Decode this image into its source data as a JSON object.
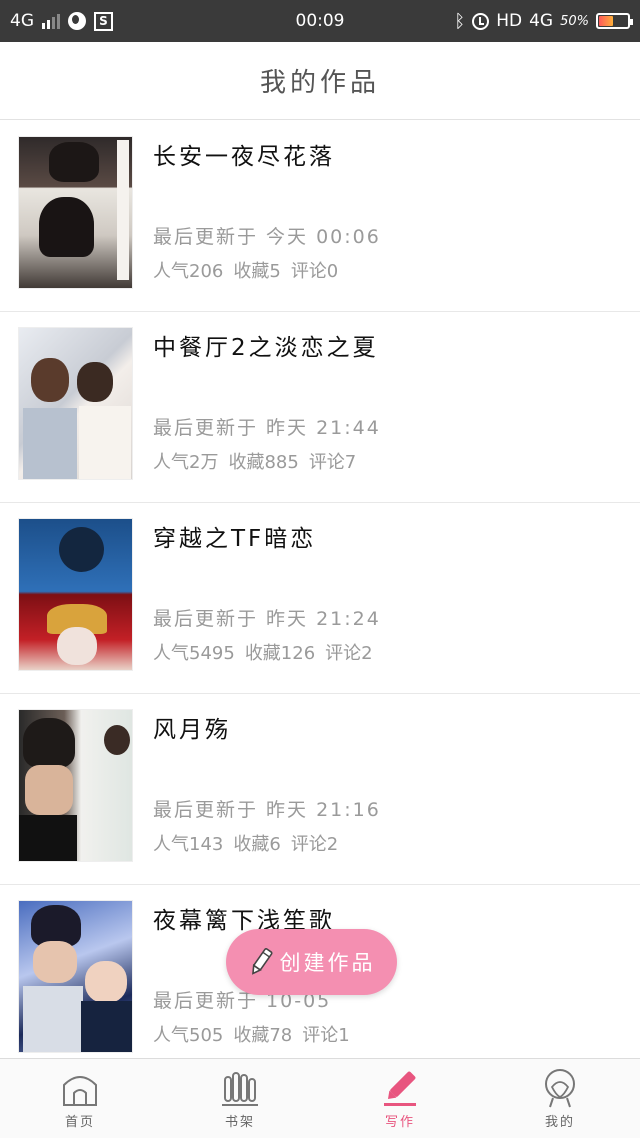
{
  "status_bar": {
    "network": "4G",
    "time": "00:09",
    "hd": "HD",
    "network_right": "4G",
    "battery_percent": "50%",
    "battery_level": 0.5,
    "icons": [
      "signal-icon",
      "globe-icon",
      "s-app-icon",
      "bluetooth-icon",
      "alarm-icon",
      "battery-icon"
    ]
  },
  "header": {
    "title": "我的作品"
  },
  "works": [
    {
      "title": "长安一夜尽花落",
      "updated": "最后更新于 今天 00:06",
      "popularity": "人气206",
      "favorites": "收藏5",
      "comments": "评论0"
    },
    {
      "title": "中餐厅2之淡恋之夏",
      "updated": "最后更新于 昨天 21:44",
      "popularity": "人气2万",
      "favorites": "收藏885",
      "comments": "评论7"
    },
    {
      "title": "穿越之TF暗恋",
      "updated": "最后更新于 昨天 21:24",
      "popularity": "人气5495",
      "favorites": "收藏126",
      "comments": "评论2"
    },
    {
      "title": "风月殇",
      "updated": "最后更新于 昨天 21:16",
      "popularity": "人气143",
      "favorites": "收藏6",
      "comments": "评论2"
    },
    {
      "title": "夜幕篱下浅笙歌",
      "updated": "最后更新于 10-05",
      "popularity": "人气505",
      "favorites": "收藏78",
      "comments": "评论1"
    }
  ],
  "fab": {
    "label": "创建作品",
    "icon": "pencil-icon",
    "color": "#f48fb1"
  },
  "tabbar": {
    "tabs": [
      {
        "label": "首页",
        "icon": "home-icon",
        "active": false
      },
      {
        "label": "书架",
        "icon": "bookshelf-icon",
        "active": false
      },
      {
        "label": "写作",
        "icon": "pencil-icon",
        "active": true
      },
      {
        "label": "我的",
        "icon": "profile-icon",
        "active": false
      }
    ],
    "active_color": "#e8557f"
  }
}
